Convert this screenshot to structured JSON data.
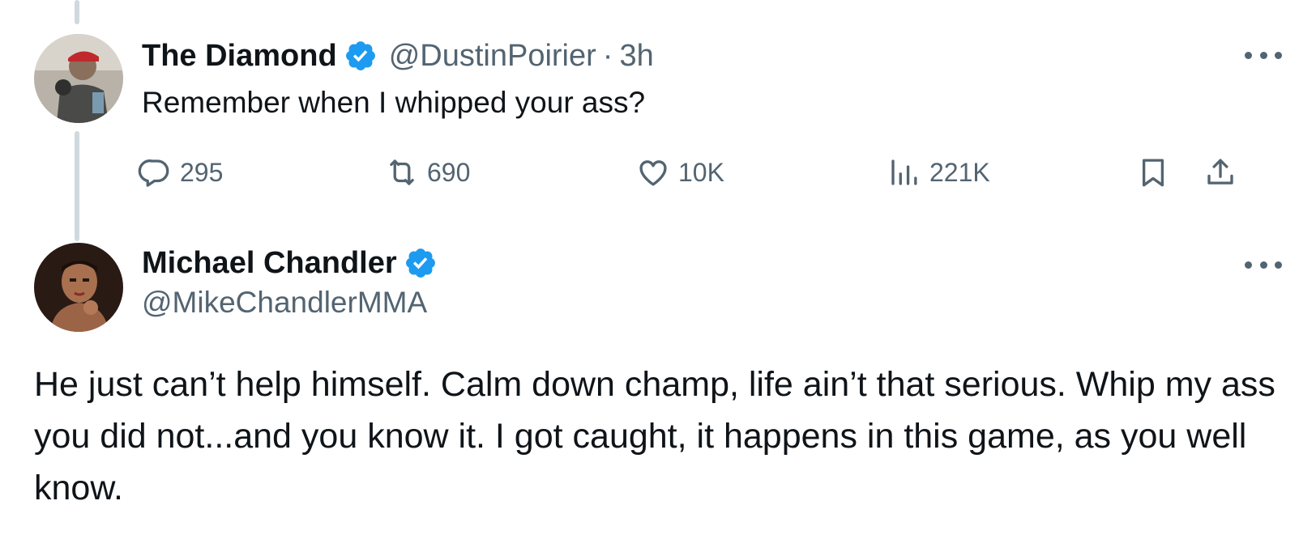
{
  "tweets": [
    {
      "display_name": "The Diamond",
      "handle": "@DustinPoirier",
      "separator": "·",
      "time": "3h",
      "text": "Remember when I whipped your ass?",
      "verified": true,
      "stats": {
        "replies": "295",
        "reposts": "690",
        "likes": "10K",
        "views": "221K"
      }
    },
    {
      "display_name": "Michael Chandler",
      "handle": "@MikeChandlerMMA",
      "verified": true,
      "text": "He just can’t help himself. Calm down champ, life ain’t that serious. Whip my ass you did not...and you know it. I got caught, it happens in this game, as you well know."
    }
  ],
  "icons": {
    "reply": "reply-icon",
    "repost": "repost-icon",
    "like": "heart-icon",
    "views": "views-icon",
    "bookmark": "bookmark-icon",
    "share": "share-icon",
    "more": "more-icon",
    "verified": "verified-badge-icon"
  },
  "colors": {
    "verified": "#1d9bf0",
    "text_primary": "#0f1419",
    "text_secondary": "#536471",
    "thread_line": "#cfd9de"
  }
}
